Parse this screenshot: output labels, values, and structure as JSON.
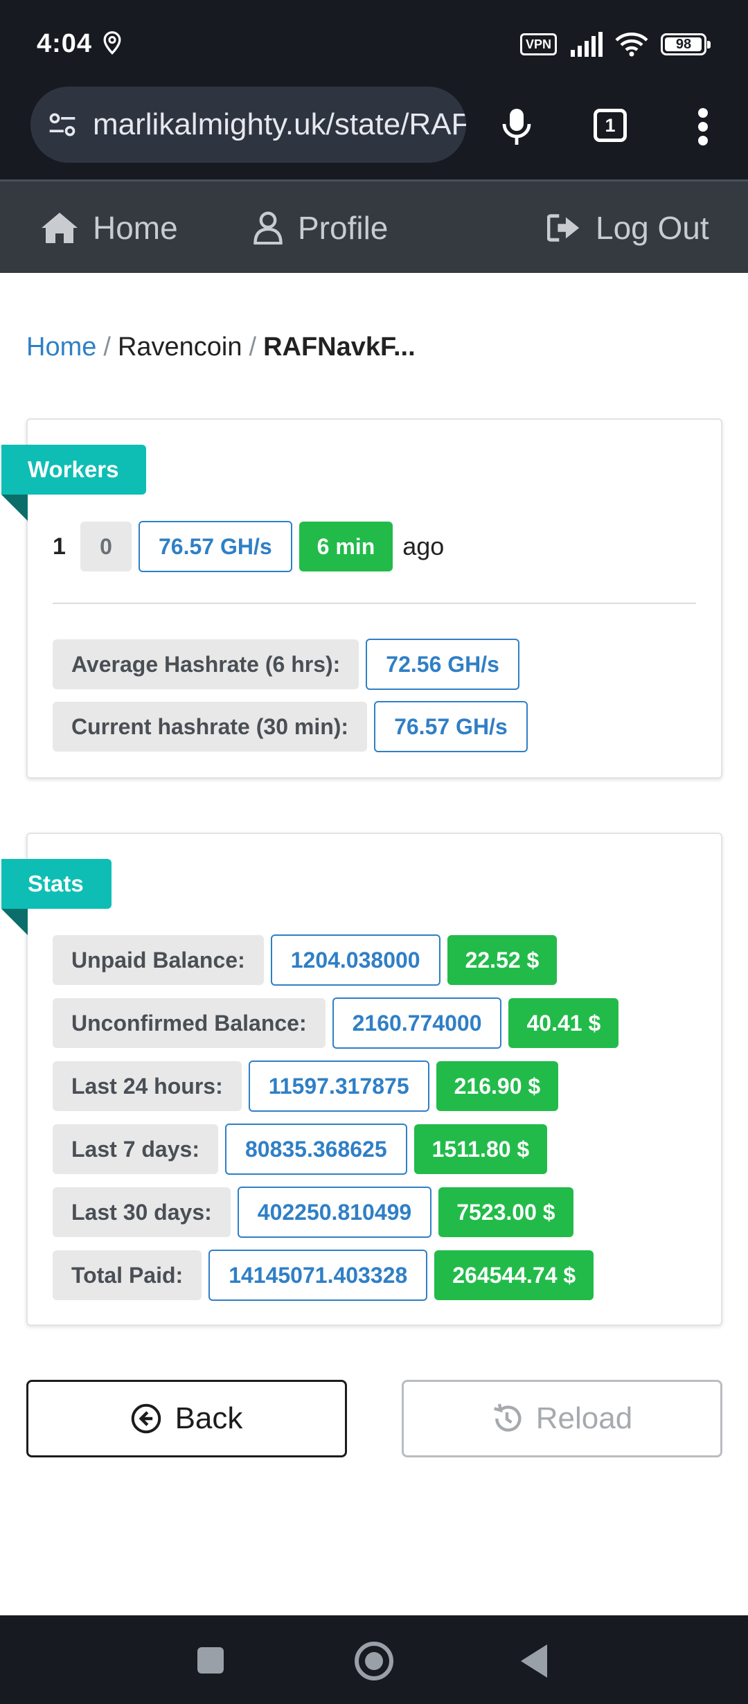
{
  "status_bar": {
    "time": "4:04",
    "vpn_label": "VPN",
    "battery_level": "98"
  },
  "browser": {
    "url": "marlikalmighty.uk/state/RAFNavkF",
    "tab_count": "1"
  },
  "site_nav": {
    "home": "Home",
    "profile": "Profile",
    "logout": "Log Out"
  },
  "breadcrumb": {
    "home": "Home",
    "sep": "/",
    "coin": "Ravencoin",
    "address": "RAFNavkF..."
  },
  "workers": {
    "title": "Workers",
    "worker_index": "1",
    "worker_badge": "0",
    "worker_hashrate": "76.57 GH/s",
    "last_seen": "6 min",
    "ago": "ago",
    "avg_label": "Average Hashrate (6 hrs):",
    "avg_value": "72.56 GH/s",
    "cur_label": "Current hashrate (30 min):",
    "cur_value": "76.57 GH/s"
  },
  "stats": {
    "title": "Stats",
    "rows": [
      {
        "label": "Unpaid Balance:",
        "value": "1204.038000",
        "usd": "22.52 $"
      },
      {
        "label": "Unconfirmed Balance:",
        "value": "2160.774000",
        "usd": "40.41 $"
      },
      {
        "label": "Last 24 hours:",
        "value": "11597.317875",
        "usd": "216.90 $"
      },
      {
        "label": "Last 7 days:",
        "value": "80835.368625",
        "usd": "1511.80 $"
      },
      {
        "label": "Last 30 days:",
        "value": "402250.810499",
        "usd": "7523.00 $"
      },
      {
        "label": "Total Paid:",
        "value": "14145071.403328",
        "usd": "264544.74 $"
      }
    ]
  },
  "buttons": {
    "back": "Back",
    "reload": "Reload"
  },
  "colors": {
    "accent_teal": "#0ebeb4",
    "link_blue": "#2f7fc6",
    "usd_green": "#22bb4a",
    "nav_bg": "#343a40"
  }
}
